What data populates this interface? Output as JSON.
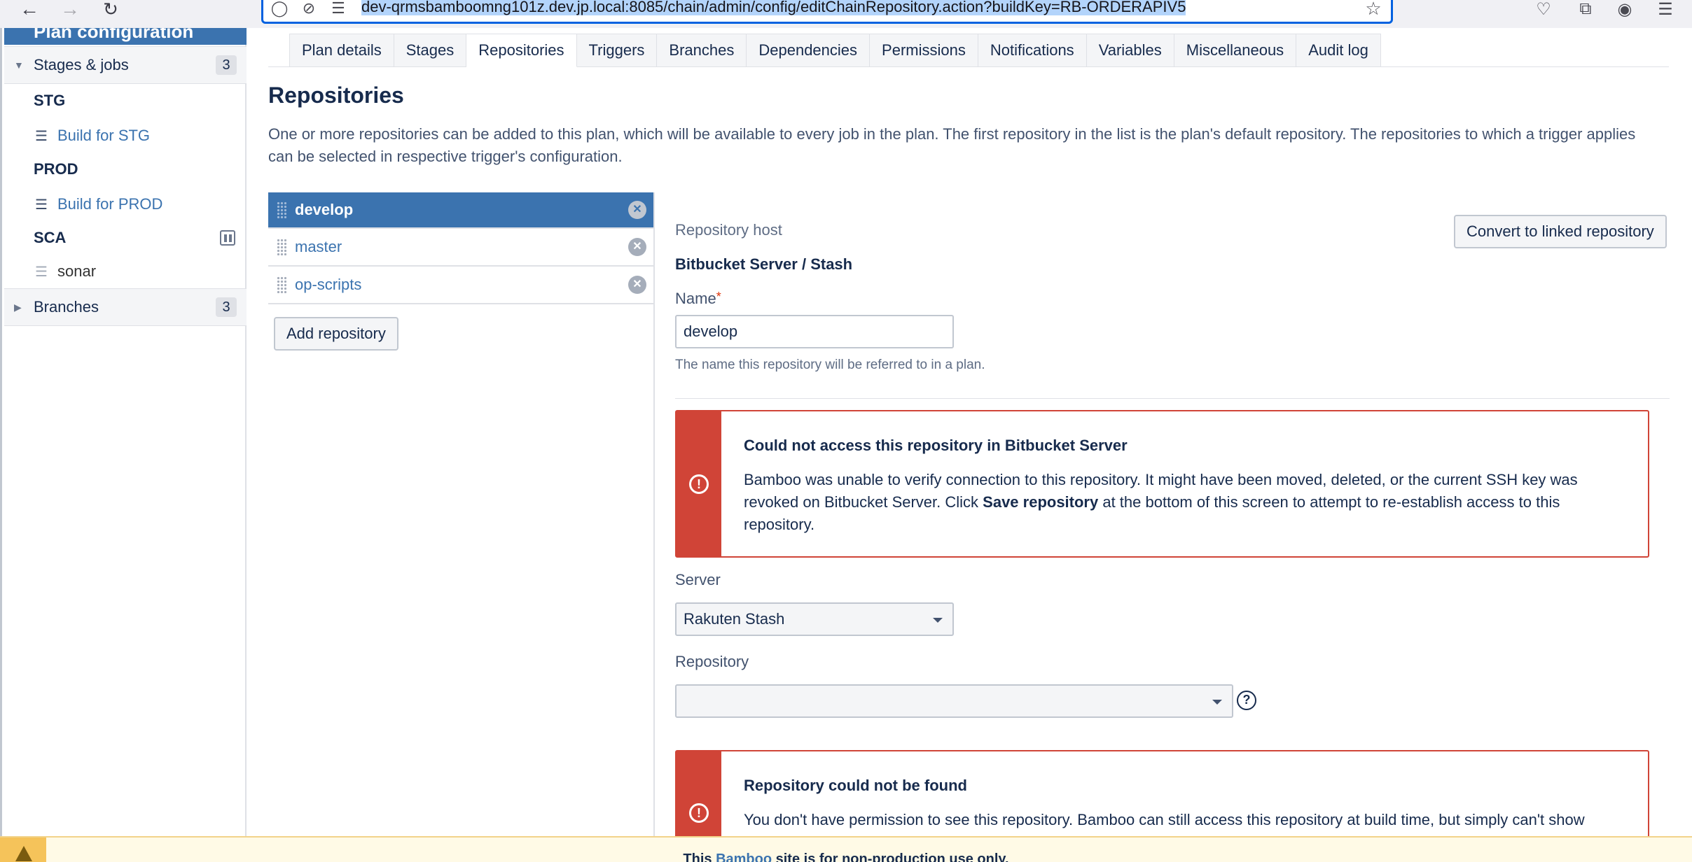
{
  "browser": {
    "url": "dev-qrmsbamboomng101z.dev.jp.local:8085/chain/admin/config/editChainRepository.action?buildKey=RB-ORDERAPIV5"
  },
  "sidebar": {
    "header": "Plan configuration",
    "stages_jobs": {
      "label": "Stages & jobs",
      "count": "3"
    },
    "stages": [
      {
        "name": "STG",
        "jobs": [
          {
            "label": "Build for STG"
          }
        ]
      },
      {
        "name": "PROD",
        "jobs": [
          {
            "label": "Build for PROD"
          }
        ]
      },
      {
        "name": "SCA",
        "jobs": [
          {
            "label": "sonar"
          }
        ]
      }
    ],
    "branches": {
      "label": "Branches",
      "count": "3"
    }
  },
  "tabs": [
    "Plan details",
    "Stages",
    "Repositories",
    "Triggers",
    "Branches",
    "Dependencies",
    "Permissions",
    "Notifications",
    "Variables",
    "Miscellaneous",
    "Audit log"
  ],
  "active_tab": "Repositories",
  "main": {
    "title": "Repositories",
    "description": "One or more repositories can be added to this plan, which will be available to every job in the plan. The first repository in the list is the plan's default repository. The repositories to which a trigger applies can be selected in respective trigger's configuration.",
    "repositories": [
      "develop",
      "master",
      "op-scripts"
    ],
    "add_repository": "Add repository"
  },
  "form": {
    "host_label": "Repository host",
    "host_value": "Bitbucket Server / Stash",
    "convert_button": "Convert to linked repository",
    "name_label": "Name",
    "required_mark": "*",
    "name_value": "develop",
    "name_hint": "The name this repository will be referred to in a plan.",
    "error1": {
      "title": "Could not access this repository in Bitbucket Server",
      "body_1": "Bamboo was unable to verify connection to this repository. It might have been moved, deleted, or the current SSH key was revoked on Bitbucket Server. Click ",
      "body_bold": "Save repository",
      "body_2": " at the bottom of this screen to attempt to re-establish access to this repository."
    },
    "server_label": "Server",
    "server_value": "Rakuten Stash",
    "repository_label": "Repository",
    "repository_value": "",
    "error2": {
      "title": "Repository could not be found",
      "body": "You don't have permission to see this repository. Bamboo can still access this repository at build time, but simply can't show"
    }
  },
  "footer": {
    "text_before": "This ",
    "link": "Bamboo",
    "text_after": " site is for non-production use only."
  },
  "colors": {
    "accent": "#3b73af",
    "error": "#d04437",
    "warning": "#f5c35a"
  }
}
